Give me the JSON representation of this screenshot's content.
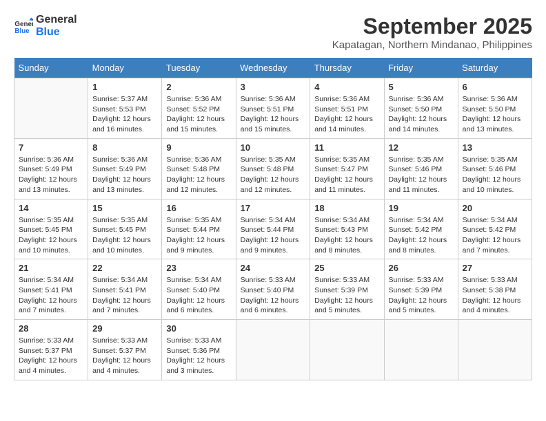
{
  "header": {
    "logo_line1": "General",
    "logo_line2": "Blue",
    "month": "September 2025",
    "location": "Kapatagan, Northern Mindanao, Philippines"
  },
  "days_of_week": [
    "Sunday",
    "Monday",
    "Tuesday",
    "Wednesday",
    "Thursday",
    "Friday",
    "Saturday"
  ],
  "weeks": [
    [
      {
        "day": "",
        "info": ""
      },
      {
        "day": "1",
        "info": "Sunrise: 5:37 AM\nSunset: 5:53 PM\nDaylight: 12 hours\nand 16 minutes."
      },
      {
        "day": "2",
        "info": "Sunrise: 5:36 AM\nSunset: 5:52 PM\nDaylight: 12 hours\nand 15 minutes."
      },
      {
        "day": "3",
        "info": "Sunrise: 5:36 AM\nSunset: 5:51 PM\nDaylight: 12 hours\nand 15 minutes."
      },
      {
        "day": "4",
        "info": "Sunrise: 5:36 AM\nSunset: 5:51 PM\nDaylight: 12 hours\nand 14 minutes."
      },
      {
        "day": "5",
        "info": "Sunrise: 5:36 AM\nSunset: 5:50 PM\nDaylight: 12 hours\nand 14 minutes."
      },
      {
        "day": "6",
        "info": "Sunrise: 5:36 AM\nSunset: 5:50 PM\nDaylight: 12 hours\nand 13 minutes."
      }
    ],
    [
      {
        "day": "7",
        "info": "Sunrise: 5:36 AM\nSunset: 5:49 PM\nDaylight: 12 hours\nand 13 minutes."
      },
      {
        "day": "8",
        "info": "Sunrise: 5:36 AM\nSunset: 5:49 PM\nDaylight: 12 hours\nand 13 minutes."
      },
      {
        "day": "9",
        "info": "Sunrise: 5:36 AM\nSunset: 5:48 PM\nDaylight: 12 hours\nand 12 minutes."
      },
      {
        "day": "10",
        "info": "Sunrise: 5:35 AM\nSunset: 5:48 PM\nDaylight: 12 hours\nand 12 minutes."
      },
      {
        "day": "11",
        "info": "Sunrise: 5:35 AM\nSunset: 5:47 PM\nDaylight: 12 hours\nand 11 minutes."
      },
      {
        "day": "12",
        "info": "Sunrise: 5:35 AM\nSunset: 5:46 PM\nDaylight: 12 hours\nand 11 minutes."
      },
      {
        "day": "13",
        "info": "Sunrise: 5:35 AM\nSunset: 5:46 PM\nDaylight: 12 hours\nand 10 minutes."
      }
    ],
    [
      {
        "day": "14",
        "info": "Sunrise: 5:35 AM\nSunset: 5:45 PM\nDaylight: 12 hours\nand 10 minutes."
      },
      {
        "day": "15",
        "info": "Sunrise: 5:35 AM\nSunset: 5:45 PM\nDaylight: 12 hours\nand 10 minutes."
      },
      {
        "day": "16",
        "info": "Sunrise: 5:35 AM\nSunset: 5:44 PM\nDaylight: 12 hours\nand 9 minutes."
      },
      {
        "day": "17",
        "info": "Sunrise: 5:34 AM\nSunset: 5:44 PM\nDaylight: 12 hours\nand 9 minutes."
      },
      {
        "day": "18",
        "info": "Sunrise: 5:34 AM\nSunset: 5:43 PM\nDaylight: 12 hours\nand 8 minutes."
      },
      {
        "day": "19",
        "info": "Sunrise: 5:34 AM\nSunset: 5:42 PM\nDaylight: 12 hours\nand 8 minutes."
      },
      {
        "day": "20",
        "info": "Sunrise: 5:34 AM\nSunset: 5:42 PM\nDaylight: 12 hours\nand 7 minutes."
      }
    ],
    [
      {
        "day": "21",
        "info": "Sunrise: 5:34 AM\nSunset: 5:41 PM\nDaylight: 12 hours\nand 7 minutes."
      },
      {
        "day": "22",
        "info": "Sunrise: 5:34 AM\nSunset: 5:41 PM\nDaylight: 12 hours\nand 7 minutes."
      },
      {
        "day": "23",
        "info": "Sunrise: 5:34 AM\nSunset: 5:40 PM\nDaylight: 12 hours\nand 6 minutes."
      },
      {
        "day": "24",
        "info": "Sunrise: 5:33 AM\nSunset: 5:40 PM\nDaylight: 12 hours\nand 6 minutes."
      },
      {
        "day": "25",
        "info": "Sunrise: 5:33 AM\nSunset: 5:39 PM\nDaylight: 12 hours\nand 5 minutes."
      },
      {
        "day": "26",
        "info": "Sunrise: 5:33 AM\nSunset: 5:39 PM\nDaylight: 12 hours\nand 5 minutes."
      },
      {
        "day": "27",
        "info": "Sunrise: 5:33 AM\nSunset: 5:38 PM\nDaylight: 12 hours\nand 4 minutes."
      }
    ],
    [
      {
        "day": "28",
        "info": "Sunrise: 5:33 AM\nSunset: 5:37 PM\nDaylight: 12 hours\nand 4 minutes."
      },
      {
        "day": "29",
        "info": "Sunrise: 5:33 AM\nSunset: 5:37 PM\nDaylight: 12 hours\nand 4 minutes."
      },
      {
        "day": "30",
        "info": "Sunrise: 5:33 AM\nSunset: 5:36 PM\nDaylight: 12 hours\nand 3 minutes."
      },
      {
        "day": "",
        "info": ""
      },
      {
        "day": "",
        "info": ""
      },
      {
        "day": "",
        "info": ""
      },
      {
        "day": "",
        "info": ""
      }
    ]
  ]
}
